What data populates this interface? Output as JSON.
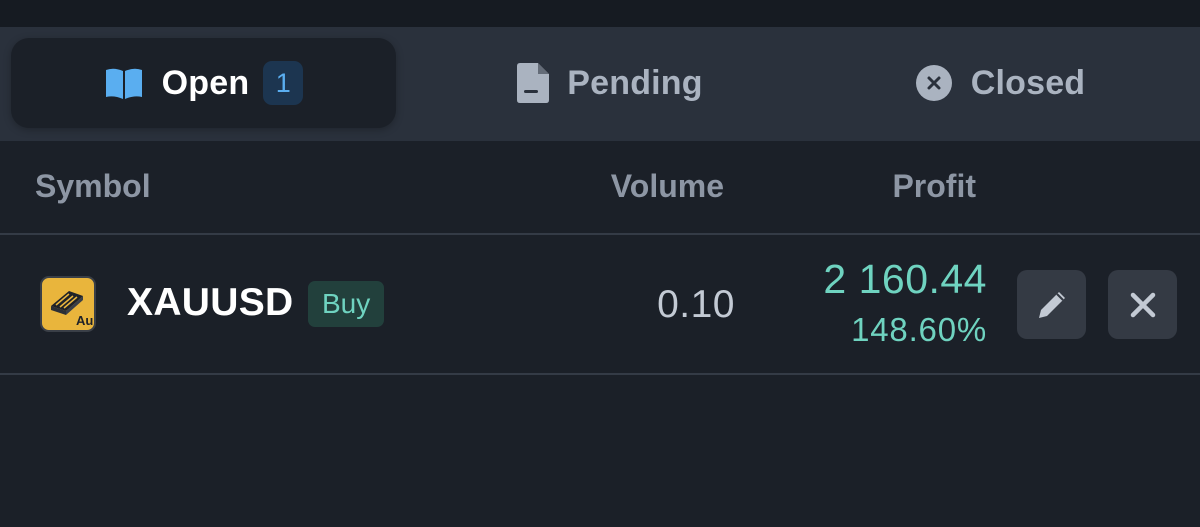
{
  "tabs": [
    {
      "label": "Open",
      "icon": "book-icon",
      "count": "1",
      "active": true
    },
    {
      "label": "Pending",
      "icon": "document-icon",
      "active": false
    },
    {
      "label": "Closed",
      "icon": "x-circle-icon",
      "active": false
    }
  ],
  "columns": {
    "symbol": "Symbol",
    "volume": "Volume",
    "profit": "Profit"
  },
  "positions": [
    {
      "symbol": "XAUUSD",
      "symbol_icon": "gold-bar-icon",
      "symbol_icon_text": "Au",
      "side": "Buy",
      "volume": "0.10",
      "profit": "2 160.44",
      "profit_percent": "148.60%",
      "actions": [
        "edit-icon",
        "close-icon"
      ]
    }
  ],
  "colors": {
    "background": "#1b2028",
    "tab_bar": "#2a313c",
    "profit_positive": "#6fd3c0",
    "badge_accent": "#5aaef0",
    "symbol_icon_gold": "#e9b53c"
  }
}
